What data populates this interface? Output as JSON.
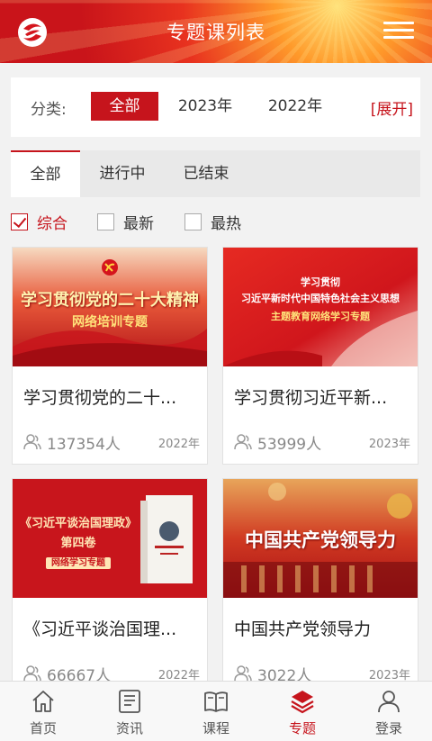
{
  "header": {
    "title": "专题课列表"
  },
  "category": {
    "label": "分类:",
    "items": [
      "全部",
      "2023年",
      "2022年"
    ],
    "expand": "[展开]"
  },
  "status_tabs": [
    "全部",
    "进行中",
    "已结束"
  ],
  "sort": [
    "综合",
    "最新",
    "最热"
  ],
  "cards": [
    {
      "title": "学习贯彻党的二十...",
      "count": "137354人",
      "year": "2022年",
      "banner_line1": "学习贯彻党的二十大精神",
      "banner_line2": "网络培训专题"
    },
    {
      "title": "学习贯彻习近平新...",
      "count": "53999人",
      "year": "2023年",
      "banner_line1": "学习贯彻",
      "banner_line2": "习近平新时代中国特色社会主义思想",
      "banner_line3": "主题教育网络学习专题"
    },
    {
      "title": "《习近平谈治国理...",
      "count": "66667人",
      "year": "2022年",
      "banner_line1": "《习近平谈治国理政》",
      "banner_line2": "第四卷",
      "banner_line3": "网络学习专题"
    },
    {
      "title": "中国共产党领导力",
      "count": "3022人",
      "year": "2023年",
      "banner_line1": "中国共产党领导力"
    }
  ],
  "nav": [
    {
      "label": "首页",
      "icon": "home-icon"
    },
    {
      "label": "资讯",
      "icon": "news-icon"
    },
    {
      "label": "课程",
      "icon": "book-icon"
    },
    {
      "label": "专题",
      "icon": "layers-icon"
    },
    {
      "label": "登录",
      "icon": "user-icon"
    }
  ],
  "colors": {
    "brand": "#c6141c",
    "header_gold": "#ffe27a"
  }
}
